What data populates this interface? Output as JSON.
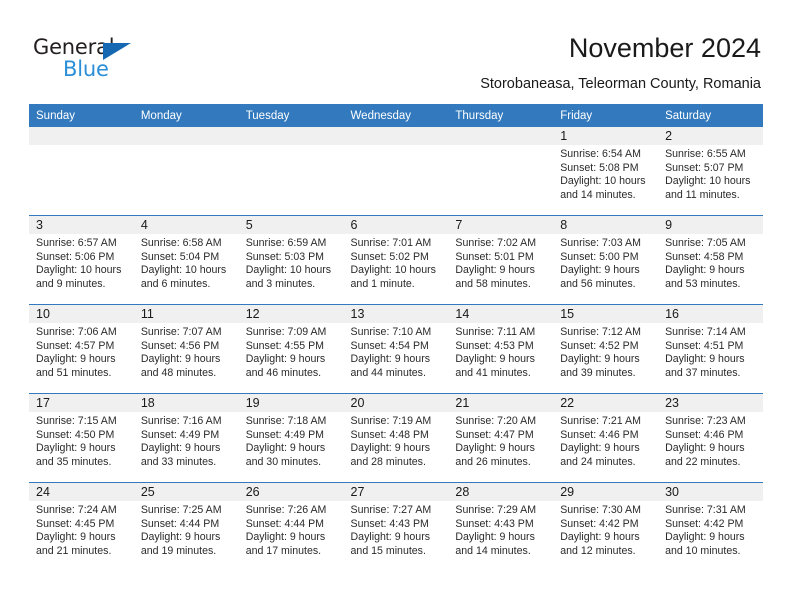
{
  "brand": {
    "word_one": "General",
    "word_two": "Blue",
    "triangle_icon": "triangle-icon",
    "color_dark": "#231f20",
    "color_blue": "#2b8fd8",
    "accent": "#3279be"
  },
  "header": {
    "title": "November 2024",
    "subtitle": "Storobaneasa, Teleorman County, Romania"
  },
  "calendar": {
    "weekday_headers": [
      "Sunday",
      "Monday",
      "Tuesday",
      "Wednesday",
      "Thursday",
      "Friday",
      "Saturday"
    ],
    "weeks": [
      [
        {
          "day": "",
          "empty": true
        },
        {
          "day": "",
          "empty": true
        },
        {
          "day": "",
          "empty": true
        },
        {
          "day": "",
          "empty": true
        },
        {
          "day": "",
          "empty": true
        },
        {
          "day": "1",
          "sunrise": "Sunrise: 6:54 AM",
          "sunset": "Sunset: 5:08 PM",
          "daylight": "Daylight: 10 hours and 14 minutes."
        },
        {
          "day": "2",
          "sunrise": "Sunrise: 6:55 AM",
          "sunset": "Sunset: 5:07 PM",
          "daylight": "Daylight: 10 hours and 11 minutes."
        }
      ],
      [
        {
          "day": "3",
          "sunrise": "Sunrise: 6:57 AM",
          "sunset": "Sunset: 5:06 PM",
          "daylight": "Daylight: 10 hours and 9 minutes."
        },
        {
          "day": "4",
          "sunrise": "Sunrise: 6:58 AM",
          "sunset": "Sunset: 5:04 PM",
          "daylight": "Daylight: 10 hours and 6 minutes."
        },
        {
          "day": "5",
          "sunrise": "Sunrise: 6:59 AM",
          "sunset": "Sunset: 5:03 PM",
          "daylight": "Daylight: 10 hours and 3 minutes."
        },
        {
          "day": "6",
          "sunrise": "Sunrise: 7:01 AM",
          "sunset": "Sunset: 5:02 PM",
          "daylight": "Daylight: 10 hours and 1 minute."
        },
        {
          "day": "7",
          "sunrise": "Sunrise: 7:02 AM",
          "sunset": "Sunset: 5:01 PM",
          "daylight": "Daylight: 9 hours and 58 minutes."
        },
        {
          "day": "8",
          "sunrise": "Sunrise: 7:03 AM",
          "sunset": "Sunset: 5:00 PM",
          "daylight": "Daylight: 9 hours and 56 minutes."
        },
        {
          "day": "9",
          "sunrise": "Sunrise: 7:05 AM",
          "sunset": "Sunset: 4:58 PM",
          "daylight": "Daylight: 9 hours and 53 minutes."
        }
      ],
      [
        {
          "day": "10",
          "sunrise": "Sunrise: 7:06 AM",
          "sunset": "Sunset: 4:57 PM",
          "daylight": "Daylight: 9 hours and 51 minutes."
        },
        {
          "day": "11",
          "sunrise": "Sunrise: 7:07 AM",
          "sunset": "Sunset: 4:56 PM",
          "daylight": "Daylight: 9 hours and 48 minutes."
        },
        {
          "day": "12",
          "sunrise": "Sunrise: 7:09 AM",
          "sunset": "Sunset: 4:55 PM",
          "daylight": "Daylight: 9 hours and 46 minutes."
        },
        {
          "day": "13",
          "sunrise": "Sunrise: 7:10 AM",
          "sunset": "Sunset: 4:54 PM",
          "daylight": "Daylight: 9 hours and 44 minutes."
        },
        {
          "day": "14",
          "sunrise": "Sunrise: 7:11 AM",
          "sunset": "Sunset: 4:53 PM",
          "daylight": "Daylight: 9 hours and 41 minutes."
        },
        {
          "day": "15",
          "sunrise": "Sunrise: 7:12 AM",
          "sunset": "Sunset: 4:52 PM",
          "daylight": "Daylight: 9 hours and 39 minutes."
        },
        {
          "day": "16",
          "sunrise": "Sunrise: 7:14 AM",
          "sunset": "Sunset: 4:51 PM",
          "daylight": "Daylight: 9 hours and 37 minutes."
        }
      ],
      [
        {
          "day": "17",
          "sunrise": "Sunrise: 7:15 AM",
          "sunset": "Sunset: 4:50 PM",
          "daylight": "Daylight: 9 hours and 35 minutes."
        },
        {
          "day": "18",
          "sunrise": "Sunrise: 7:16 AM",
          "sunset": "Sunset: 4:49 PM",
          "daylight": "Daylight: 9 hours and 33 minutes."
        },
        {
          "day": "19",
          "sunrise": "Sunrise: 7:18 AM",
          "sunset": "Sunset: 4:49 PM",
          "daylight": "Daylight: 9 hours and 30 minutes."
        },
        {
          "day": "20",
          "sunrise": "Sunrise: 7:19 AM",
          "sunset": "Sunset: 4:48 PM",
          "daylight": "Daylight: 9 hours and 28 minutes."
        },
        {
          "day": "21",
          "sunrise": "Sunrise: 7:20 AM",
          "sunset": "Sunset: 4:47 PM",
          "daylight": "Daylight: 9 hours and 26 minutes."
        },
        {
          "day": "22",
          "sunrise": "Sunrise: 7:21 AM",
          "sunset": "Sunset: 4:46 PM",
          "daylight": "Daylight: 9 hours and 24 minutes."
        },
        {
          "day": "23",
          "sunrise": "Sunrise: 7:23 AM",
          "sunset": "Sunset: 4:46 PM",
          "daylight": "Daylight: 9 hours and 22 minutes."
        }
      ],
      [
        {
          "day": "24",
          "sunrise": "Sunrise: 7:24 AM",
          "sunset": "Sunset: 4:45 PM",
          "daylight": "Daylight: 9 hours and 21 minutes."
        },
        {
          "day": "25",
          "sunrise": "Sunrise: 7:25 AM",
          "sunset": "Sunset: 4:44 PM",
          "daylight": "Daylight: 9 hours and 19 minutes."
        },
        {
          "day": "26",
          "sunrise": "Sunrise: 7:26 AM",
          "sunset": "Sunset: 4:44 PM",
          "daylight": "Daylight: 9 hours and 17 minutes."
        },
        {
          "day": "27",
          "sunrise": "Sunrise: 7:27 AM",
          "sunset": "Sunset: 4:43 PM",
          "daylight": "Daylight: 9 hours and 15 minutes."
        },
        {
          "day": "28",
          "sunrise": "Sunrise: 7:29 AM",
          "sunset": "Sunset: 4:43 PM",
          "daylight": "Daylight: 9 hours and 14 minutes."
        },
        {
          "day": "29",
          "sunrise": "Sunrise: 7:30 AM",
          "sunset": "Sunset: 4:42 PM",
          "daylight": "Daylight: 9 hours and 12 minutes."
        },
        {
          "day": "30",
          "sunrise": "Sunrise: 7:31 AM",
          "sunset": "Sunset: 4:42 PM",
          "daylight": "Daylight: 9 hours and 10 minutes."
        }
      ]
    ]
  }
}
